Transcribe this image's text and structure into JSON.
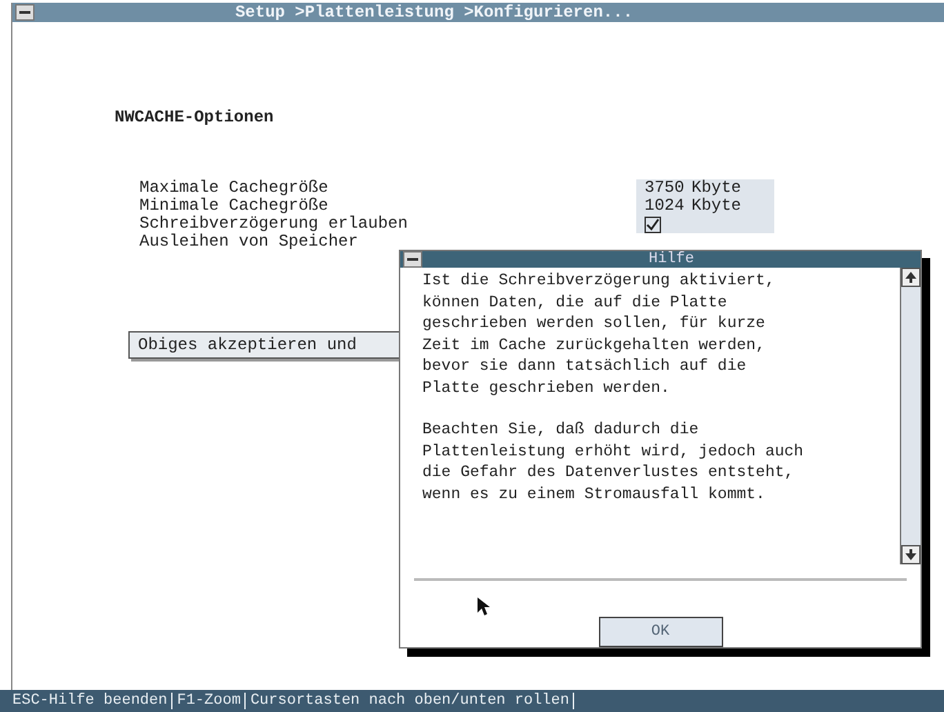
{
  "window": {
    "title": "Setup >Plattenleistung >Konfigurieren..."
  },
  "section_title": "NWCACHE-Optionen",
  "options": [
    {
      "label": "Maximale Cachegröße",
      "kind": "number",
      "value": "3750",
      "unit": "Kbyte"
    },
    {
      "label": "Minimale Cachegröße",
      "kind": "number",
      "value": "1024",
      "unit": "Kbyte"
    },
    {
      "label": "Schreibverzögerung erlauben",
      "kind": "checkbox",
      "checked": true
    },
    {
      "label": "Ausleihen von Speicher",
      "kind": "hidden"
    }
  ],
  "accept_button": "Obiges akzeptieren und",
  "help_dialog": {
    "title": "Hilfe",
    "paragraphs": [
      [
        "Ist die Schreibverzögerung aktiviert,",
        "können Daten, die auf die Platte",
        "geschrieben werden sollen, für kurze",
        "Zeit im Cache zurückgehalten werden,",
        "bevor sie dann tatsächlich auf die",
        "Platte geschrieben werden."
      ],
      [
        "Beachten Sie, daß dadurch die",
        "Plattenleistung erhöht wird, jedoch auch",
        "die Gefahr des Datenverlustes entsteht,",
        "wenn es zu einem Stromausfall kommt."
      ]
    ],
    "ok_button": "OK"
  },
  "status_bar": [
    "ESC-Hilfe beenden",
    "F1-Zoom",
    "Cursortasten nach oben/unten rollen"
  ]
}
